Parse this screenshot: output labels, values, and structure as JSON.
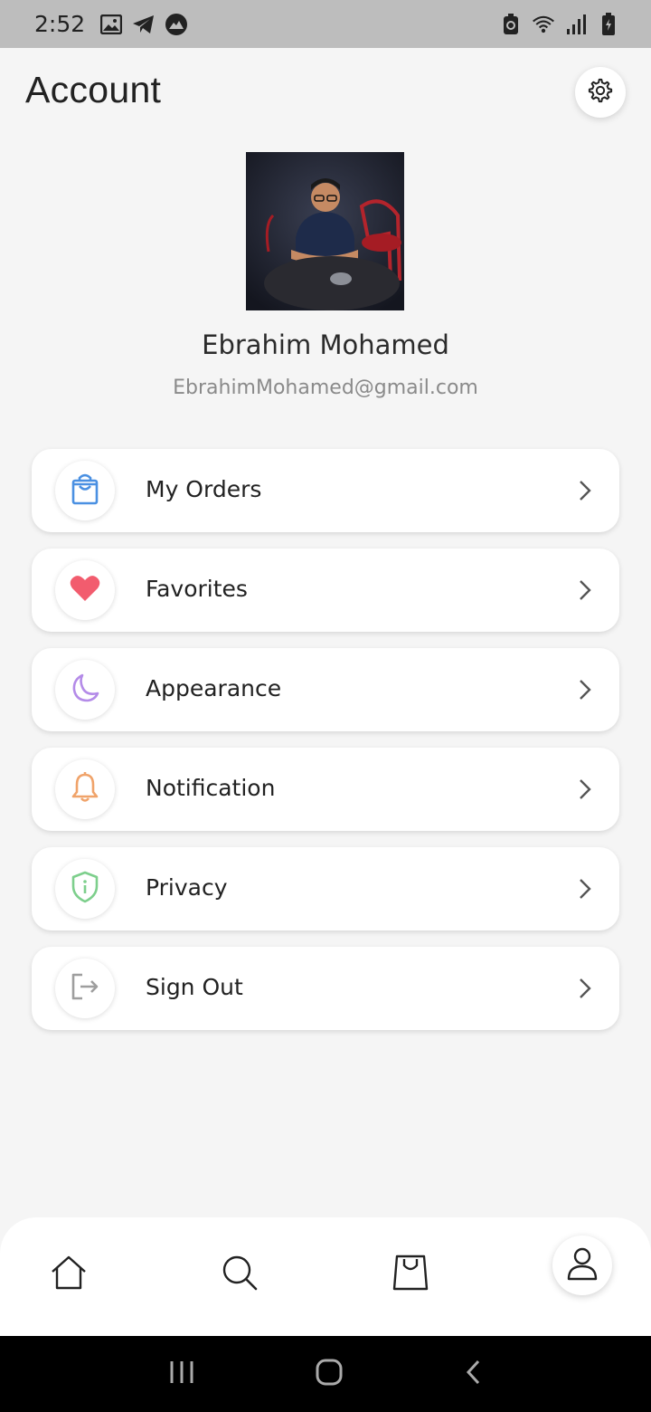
{
  "status_bar": {
    "time": "2:52",
    "left_icons": [
      "image-icon",
      "telegram-icon",
      "mountain-app-icon"
    ],
    "right_icons": [
      "recycle-icon",
      "wifi-icon",
      "signal-icon",
      "battery-icon"
    ]
  },
  "header": {
    "title": "Account",
    "settings_icon": "gear-icon"
  },
  "profile": {
    "name": "Ebrahim Mohamed",
    "email": "EbrahimMohamed@gmail.com"
  },
  "menu": {
    "items": [
      {
        "label": "My Orders",
        "icon": "shopping-bag-icon",
        "color": "#4a90e2"
      },
      {
        "label": "Favorites",
        "icon": "heart-icon",
        "color": "#f25c6e"
      },
      {
        "label": "Appearance",
        "icon": "moon-icon",
        "color": "#b48be8"
      },
      {
        "label": "Notification",
        "icon": "bell-icon",
        "color": "#f0a36a"
      },
      {
        "label": "Privacy",
        "icon": "shield-icon",
        "color": "#7dcf8c"
      },
      {
        "label": "Sign Out",
        "icon": "logout-icon",
        "color": "#9e9e9e"
      }
    ]
  },
  "bottom_nav": {
    "items": [
      "home-icon",
      "search-icon",
      "bag-icon",
      "profile-icon"
    ],
    "active": "profile-icon"
  },
  "system_nav": [
    "recent-apps-icon",
    "home-circle-icon",
    "back-icon"
  ]
}
